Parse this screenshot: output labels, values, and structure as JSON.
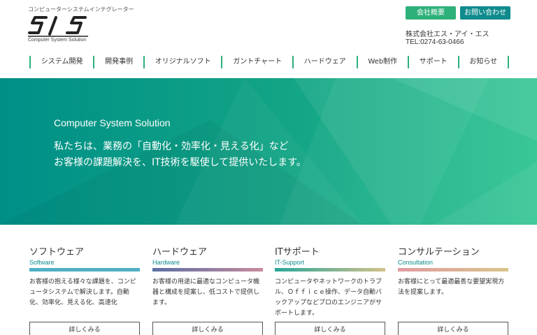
{
  "header": {
    "tagline": "コンピューターシステムインテグレーター",
    "logo_sub": "Computer System Solution",
    "about_label": "会社概要",
    "contact_label": "お問い合わせ",
    "company_name": "株式会社エス・アイ・エス",
    "tel": "TEL:0274-63-0466"
  },
  "nav": {
    "items": [
      {
        "label": "システム開発"
      },
      {
        "label": "開発事例"
      },
      {
        "label": "オリジナルソフト"
      },
      {
        "label": "ガントチャート"
      },
      {
        "label": "ハードウェア"
      },
      {
        "label": "Web制作"
      },
      {
        "label": "サポート"
      },
      {
        "label": "お知らせ"
      }
    ]
  },
  "hero": {
    "subtitle": "Computer System Solution",
    "line1": "私たちは、業務の「自動化・効率化・見える化」など",
    "line2": "お客様の課題解決を、IT技術を駆使して提供いたします。"
  },
  "services": [
    {
      "title": "ソフトウェア",
      "en": "Software",
      "desc": "お客様の抱える様々な課題を、コンピュータシステムで解決します。自動化、効率化、見える化、高速化",
      "button": "詳しくみる"
    },
    {
      "title": "ハードウェア",
      "en": "Hardware",
      "desc": "お客様の用途に最適なコンピュータ機器と構成を提案し、低コストで提供します。",
      "button": "詳しくみる"
    },
    {
      "title": "ITサポート",
      "en": "IT-Support",
      "desc": "コンピュータやネットワークのトラブル、Ｏｆｆｉｃｅ操作、データ自動バックアップなどプロのエンジニアがサポートします。",
      "button": "詳しくみる"
    },
    {
      "title": "コンサルテーション",
      "en": "Consultation",
      "desc": "お客様にとって最適最善な要望実現方法を提案します。",
      "button": "詳しくみる"
    }
  ],
  "colors": {
    "accent_green": "#2eb07a",
    "accent_teal": "#0f8b8d",
    "hero_start": "#008f87",
    "hero_end": "#2bc38f"
  }
}
